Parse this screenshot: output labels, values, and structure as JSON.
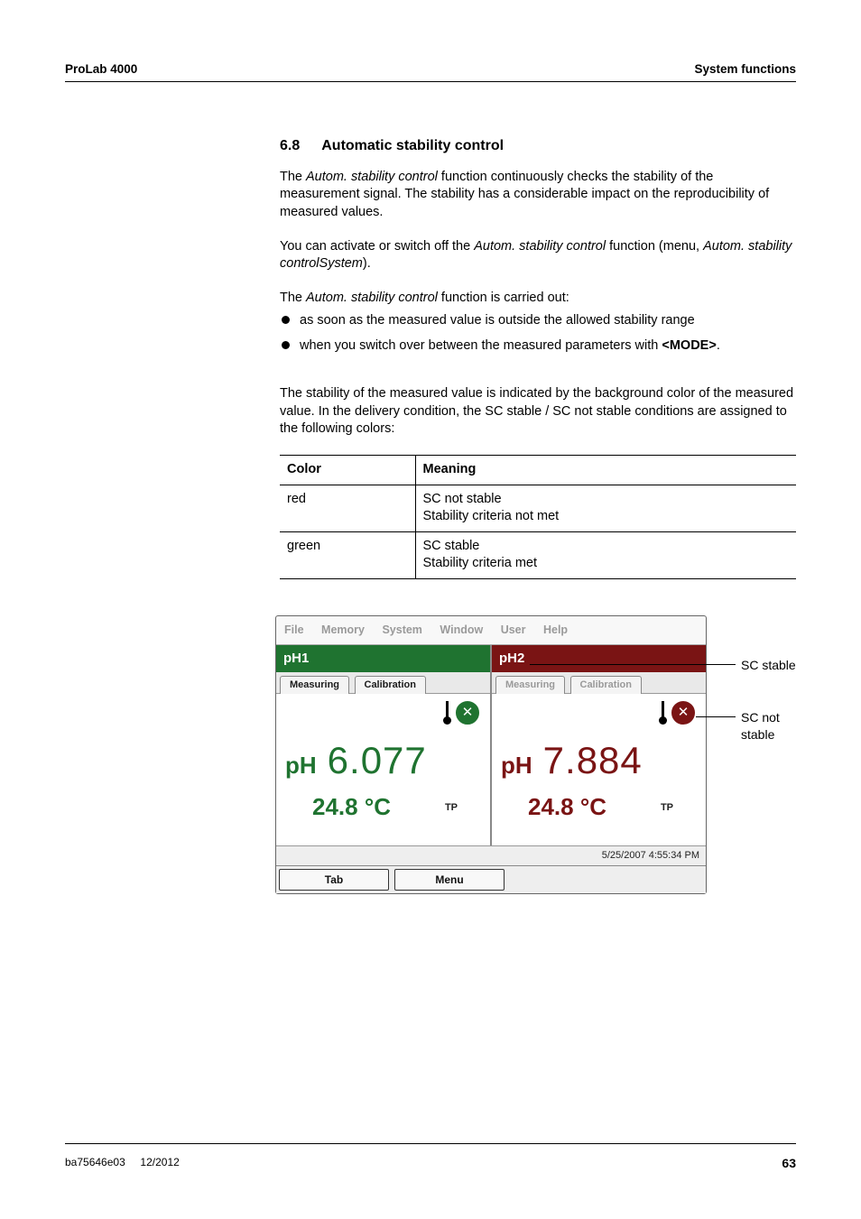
{
  "header": {
    "left": "ProLab 4000",
    "right": "System functions"
  },
  "section": {
    "number": "6.8",
    "title": "Automatic stability control"
  },
  "paragraphs": {
    "p1_before": "The ",
    "p1_em1": "Autom. stability control",
    "p1_after": " function continuously checks the stability of the measurement signal. The stability has a considerable impact on the reproducibility of measured values.",
    "p2_before": "You can activate or switch off the ",
    "p2_em1": "Autom. stability control",
    "p2_mid": " function (menu, ",
    "p2_em2": "Autom. stability controlSystem",
    "p2_after": ").",
    "p3_before": "The ",
    "p3_em1": "Autom. stability control",
    "p3_after": " function is carried out:",
    "bullet1": "as soon as the measured value is outside the allowed stability range",
    "bullet2_before": "when you switch over between the measured parameters with ",
    "bullet2_strong": "<MODE>",
    "bullet2_after": ".",
    "p4": "The stability of the measured value is indicated by the background color of the measured value. In the delivery condition, the SC stable / SC not stable conditions are assigned to the following colors:"
  },
  "table": {
    "head_color": "Color",
    "head_meaning": "Meaning",
    "rows": [
      {
        "color": "red",
        "line1": "SC not stable",
        "line2": "Stability criteria not met"
      },
      {
        "color": "green",
        "line1": "SC stable",
        "line2": "Stability criteria met"
      }
    ]
  },
  "device": {
    "menubar": [
      "File",
      "Memory",
      "System",
      "Window",
      "User",
      "Help"
    ],
    "panel1": {
      "title": "pH1",
      "tab1": "Measuring",
      "tab2": "Calibration",
      "unit": "pH",
      "value": "6.077",
      "temp": "24.8 °C",
      "tp": "TP"
    },
    "panel2": {
      "title": "pH2",
      "tab1": "Measuring",
      "tab2": "Calibration",
      "unit": "pH",
      "value": "7.884",
      "temp": "24.8 °C",
      "tp": "TP"
    },
    "timestamp": "5/25/2007 4:55:34 PM",
    "btn_tab": "Tab",
    "btn_menu": "Menu"
  },
  "callouts": {
    "sc_stable": "SC stable",
    "sc_not_stable": "SC not stable"
  },
  "footer": {
    "doc": "ba75646e03",
    "date": "12/2012",
    "page": "63"
  }
}
